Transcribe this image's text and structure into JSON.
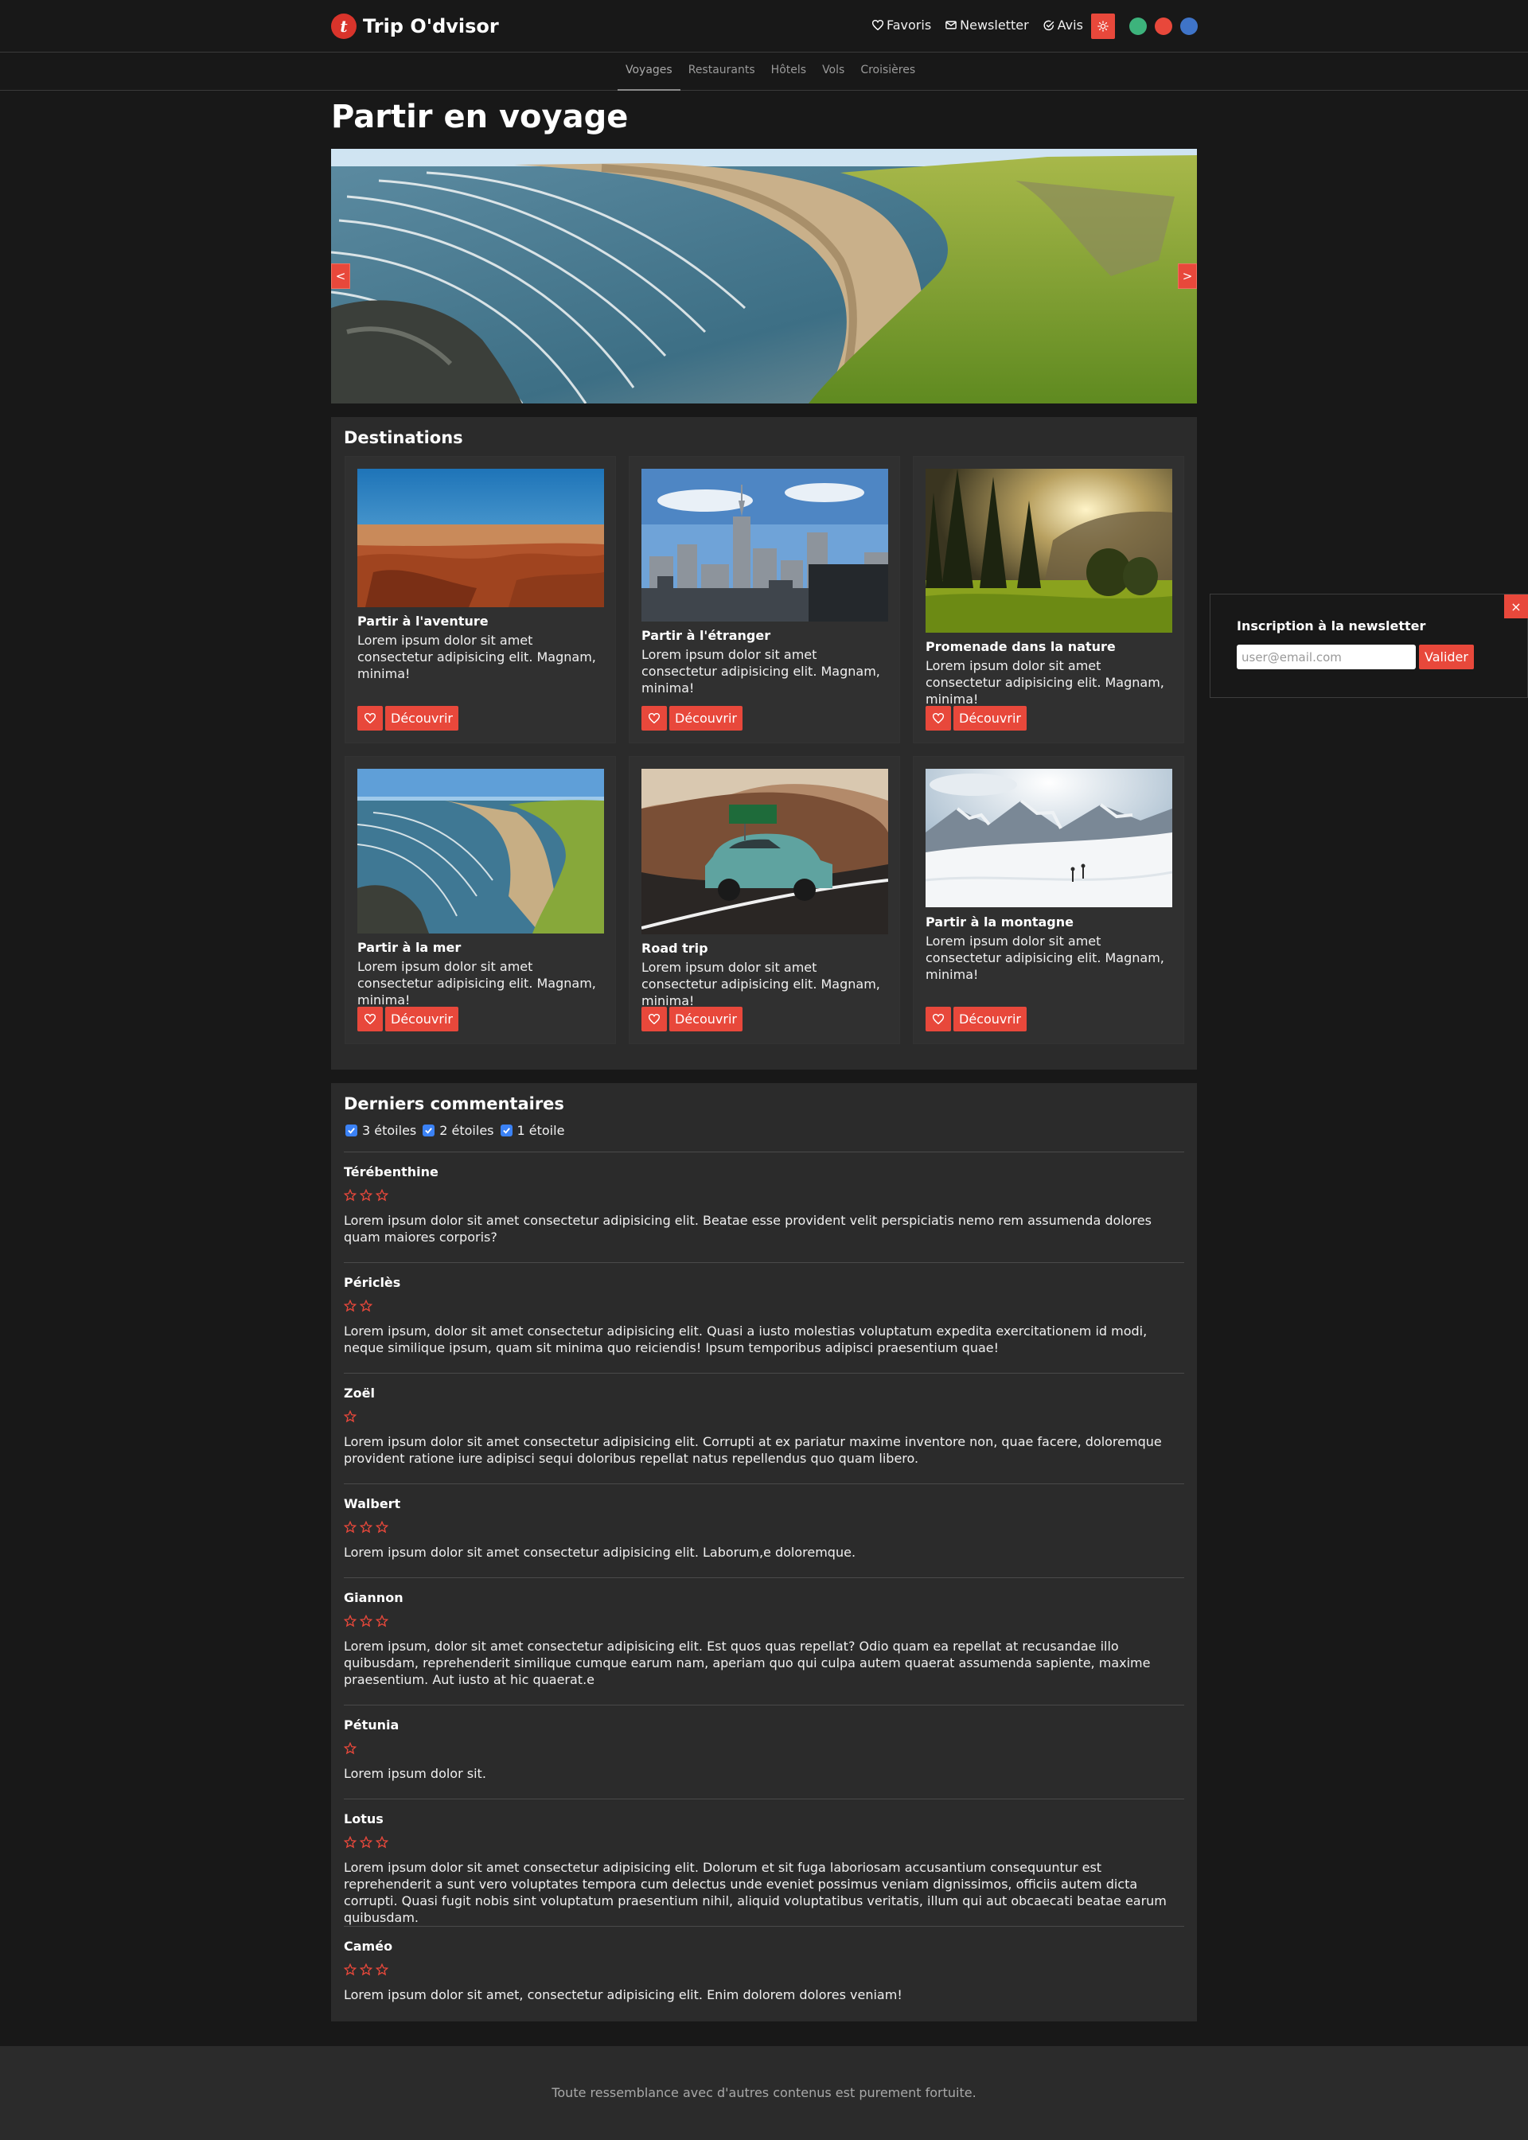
{
  "header": {
    "brand_letter": "t",
    "brand_name": "Trip O'dvisor",
    "links": [
      "Favoris",
      "Newsletter",
      "Avis"
    ]
  },
  "subnav": {
    "items": [
      "Voyages",
      "Restaurants",
      "Hôtels",
      "Vols",
      "Croisières"
    ],
    "active": "Voyages"
  },
  "page": {
    "title": "Partir en voyage",
    "carousel_prev": "<",
    "carousel_next": ">"
  },
  "destinations": {
    "title": "Destinations",
    "cards": [
      {
        "title": "Partir à l'aventure",
        "text": "Lorem ipsum dolor sit amet consectetur adipisicing elit. Magnam, minima!",
        "button": "Découvrir"
      },
      {
        "title": "Partir à l'étranger",
        "text": "Lorem ipsum dolor sit amet consectetur adipisicing elit. Magnam, minima!",
        "button": "Découvrir"
      },
      {
        "title": "Promenade dans la nature",
        "text": "Lorem ipsum dolor sit amet consectetur adipisicing elit. Magnam, minima!",
        "button": "Découvrir"
      },
      {
        "title": "Partir à la mer",
        "text": "Lorem ipsum dolor sit amet consectetur adipisicing elit. Magnam, minima!",
        "button": "Découvrir"
      },
      {
        "title": "Road trip",
        "text": "Lorem ipsum dolor sit amet consectetur adipisicing elit. Magnam, minima!",
        "button": "Découvrir"
      },
      {
        "title": "Partir à la montagne",
        "text": "Lorem ipsum dolor sit amet consectetur adipisicing elit. Magnam, minima!",
        "button": "Découvrir"
      }
    ]
  },
  "comments": {
    "title": "Derniers commentaires",
    "filters": [
      {
        "label": "3 étoiles",
        "checked": true
      },
      {
        "label": "2 étoiles",
        "checked": true
      },
      {
        "label": "1 étoile",
        "checked": true
      }
    ],
    "items": [
      {
        "name": "Térébenthine",
        "stars": 3,
        "text": "Lorem ipsum dolor sit amet consectetur adipisicing elit. Beatae esse provident velit perspiciatis nemo rem assumenda dolores quam maiores corporis?"
      },
      {
        "name": "Périclès",
        "stars": 2,
        "text": "Lorem ipsum, dolor sit amet consectetur adipisicing elit. Quasi a iusto molestias voluptatum expedita exercitationem id modi, neque similique ipsum, quam sit minima quo reiciendis! Ipsum temporibus adipisci praesentium quae!"
      },
      {
        "name": "Zoël",
        "stars": 1,
        "text": "Lorem ipsum dolor sit amet consectetur adipisicing elit. Corrupti at ex pariatur maxime inventore non, quae facere, doloremque provident ratione iure adipisci sequi doloribus repellat natus repellendus quo quam libero."
      },
      {
        "name": "Walbert",
        "stars": 3,
        "text": "Lorem ipsum dolor sit amet consectetur adipisicing elit. Laborum,e doloremque."
      },
      {
        "name": "Giannon",
        "stars": 3,
        "text": "Lorem ipsum, dolor sit amet consectetur adipisicing elit. Est quos quas repellat? Odio quam ea repellat at recusandae illo quibusdam, reprehenderit similique cumque earum nam, aperiam quo qui culpa autem quaerat assumenda sapiente, maxime praesentium. Aut iusto at hic quaerat.e"
      },
      {
        "name": "Pétunia",
        "stars": 1,
        "text": "Lorem ipsum dolor sit."
      },
      {
        "name": "Lotus",
        "stars": 3,
        "text": "Lorem ipsum dolor sit amet consectetur adipisicing elit. Dolorum et sit fuga laboriosam accusantium consequuntur est reprehenderit a sunt vero voluptates tempora cum delectus unde eveniet possimus veniam dignissimos, officiis autem dicta corrupti. Quasi fugit nobis sint voluptatum praesentium nihil, aliquid voluptatibus veritatis, illum qui aut obcaecati beatae earum quibusdam."
      },
      {
        "name": "Caméo",
        "stars": 3,
        "text": "Lorem ipsum dolor sit amet, consectetur adipisicing elit. Enim dolorem dolores veniam!"
      }
    ]
  },
  "newsletter": {
    "title": "Inscription à la newsletter",
    "placeholder": "user@email.com",
    "submit": "Valider",
    "close": "×"
  },
  "footer": {
    "text": "Toute ressemblance avec d'autres contenus est purement fortuite."
  },
  "colors": {
    "accent": "#e8483b",
    "background": "#181818",
    "panel": "#2b2b2b",
    "card": "#303030",
    "theme_dots": [
      "#3db37c",
      "#e8483b",
      "#3f74c8"
    ]
  }
}
